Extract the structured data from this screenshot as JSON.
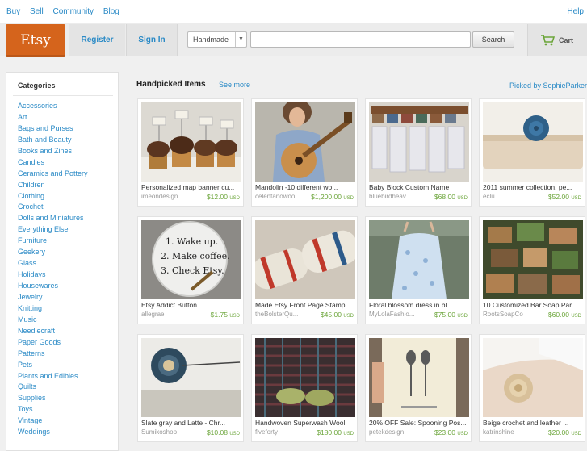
{
  "topnav": {
    "links": [
      "Buy",
      "Sell",
      "Community",
      "Blog"
    ],
    "help": "Help"
  },
  "header": {
    "logo": "Etsy",
    "register": "Register",
    "signin": "Sign In",
    "search": {
      "category": "Handmade",
      "button": "Search",
      "value": ""
    },
    "cart": "Cart"
  },
  "sidebar": {
    "heading": "Categories",
    "categories": [
      "Accessories",
      "Art",
      "Bags and Purses",
      "Bath and Beauty",
      "Books and Zines",
      "Candles",
      "Ceramics and Pottery",
      "Children",
      "Clothing",
      "Crochet",
      "Dolls and Miniatures",
      "Everything Else",
      "Furniture",
      "Geekery",
      "Glass",
      "Holidays",
      "Housewares",
      "Jewelry",
      "Knitting",
      "Music",
      "Needlecraft",
      "Paper Goods",
      "Patterns",
      "Pets",
      "Plants and Edibles",
      "Quilts",
      "Supplies",
      "Toys",
      "Vintage",
      "Weddings"
    ]
  },
  "main": {
    "title": "Handpicked Items",
    "see_more": "See more",
    "picked_by": "Picked by SophieParker",
    "currency": "USD",
    "items": [
      {
        "title": "Personalized map banner cu...",
        "shop": "imeondesign",
        "price": "$12.00"
      },
      {
        "title": "Mandolin -10 different wo...",
        "shop": "celentanowoo...",
        "price": "$1,200.00"
      },
      {
        "title": "Baby Block Custom Name",
        "shop": "bluebirdheav...",
        "price": "$68.00"
      },
      {
        "title": "2011 summer collection, pe...",
        "shop": "eclu",
        "price": "$52.00"
      },
      {
        "title": "Etsy Addict Button",
        "shop": "allegrae",
        "price": "$1.75"
      },
      {
        "title": "Made Etsy Front Page Stamp...",
        "shop": "theBolsterQu...",
        "price": "$45.00"
      },
      {
        "title": "Floral blossom dress in bl...",
        "shop": "MyLolaFashio...",
        "price": "$75.00"
      },
      {
        "title": "10 Customized Bar Soap Par...",
        "shop": "RootsSoapCo",
        "price": "$60.00"
      },
      {
        "title": "Slate gray and Latte - Chr...",
        "shop": "Sumikoshop",
        "price": "$10.08"
      },
      {
        "title": "Handwoven Superwash Wool",
        "shop": "fiveforty",
        "price": "$180.00"
      },
      {
        "title": "20% OFF Sale: Spooning Pos...",
        "shop": "petekdesign",
        "price": "$23.00"
      },
      {
        "title": "Beige crochet and leather ...",
        "shop": "katrinshine",
        "price": "$20.00"
      }
    ],
    "button_text": [
      "1. Wake up.",
      "2. Make coffee.",
      "3. Check Etsy."
    ]
  },
  "colors": {
    "link": "#2a8ac6",
    "logo": "#d5641c",
    "price": "#6ba539"
  }
}
